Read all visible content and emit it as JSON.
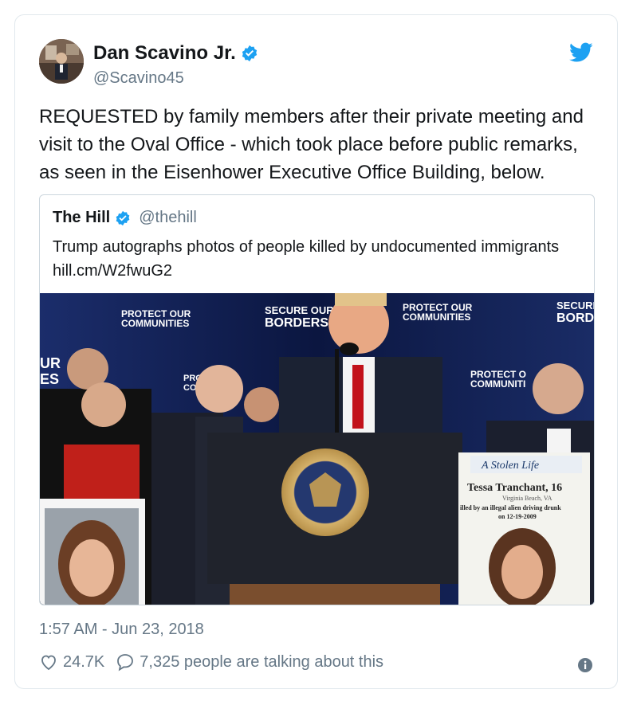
{
  "author": {
    "name": "Dan Scavino Jr.",
    "handle": "@Scavino45",
    "verified": true
  },
  "tweet": {
    "text": "REQUESTED by family members after their private meeting and visit to the Oval Office - which took place before public remarks, as seen in the Eisenhower Executive Office Building, below."
  },
  "quoted": {
    "name": "The Hill",
    "handle": "@thehill",
    "verified": true,
    "text": "Trump autographs photos of people killed by undocumented immigrants hill.cm/W2fwuG2",
    "image": {
      "signs": [
        "PROTECT OUR",
        "COMMUNITIES",
        "SECURE OUR",
        "BORDERS",
        "PROTECT OUR",
        "COMMUNITIES",
        "SECURE",
        "BORD",
        "UR",
        "ES",
        "PRO",
        "CO",
        "PROTECT O",
        "COMMUNITI"
      ],
      "seal_text": "SEAL OF THE PRESIDENT OF THE UNITED STATES",
      "poster": {
        "title": "A Stolen Life",
        "name": "Tessa Tranchant, 16",
        "place": "Virginia Beach, VA",
        "caption": "illed by an illegal alien driving drunk",
        "date": "on 12-19-2009"
      }
    }
  },
  "meta": {
    "timestamp": "1:57 AM - Jun 23, 2018",
    "likes": "24.7K",
    "talking": "7,325 people are talking about this"
  },
  "colors": {
    "brand_blue": "#1da1f2",
    "secondary_text": "#657786",
    "border": "#e1e8ed"
  },
  "icons": [
    "twitter-bird-icon",
    "verified-badge-icon",
    "heart-icon",
    "reply-bubble-icon",
    "info-icon"
  ]
}
